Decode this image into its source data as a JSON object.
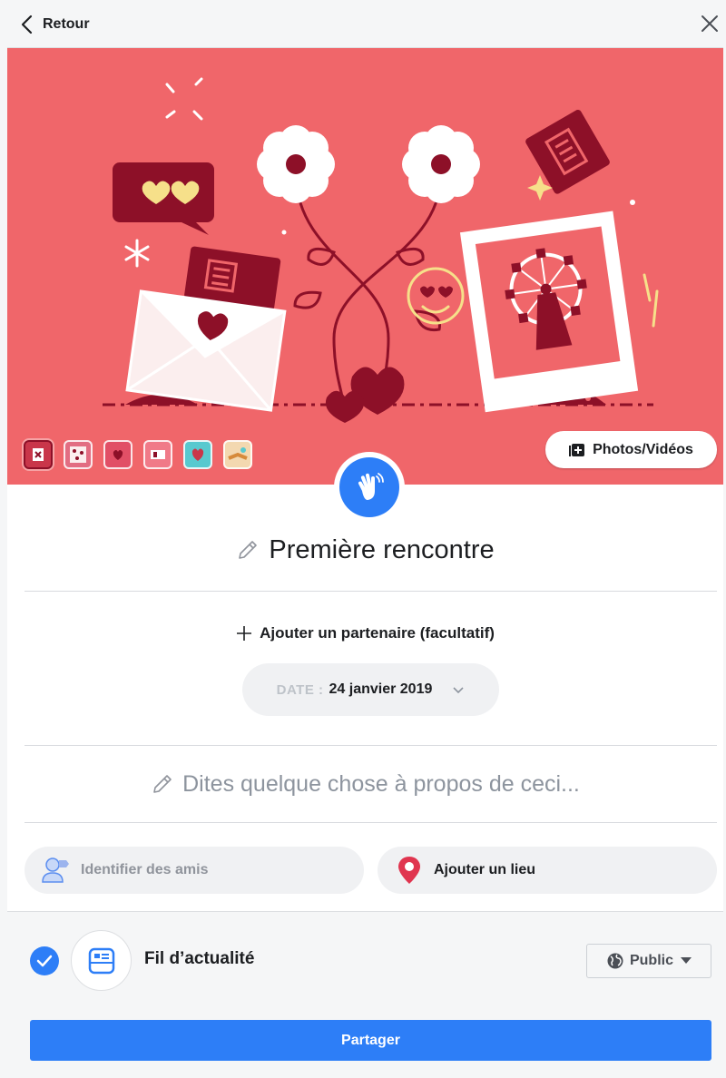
{
  "header": {
    "back_label": "Retour"
  },
  "banner": {
    "photos_button_label": "Photos/Vidéos",
    "thumbnails": [
      {
        "name": "envelope-x",
        "bg": "#c9364a"
      },
      {
        "name": "hearts-pattern",
        "bg": "#e26d82"
      },
      {
        "name": "heart-card",
        "bg": "#e14f66"
      },
      {
        "name": "tickets",
        "bg": "#f07a88"
      },
      {
        "name": "heart-teal",
        "bg": "#58c9cf"
      },
      {
        "name": "hands",
        "bg": "#f3d8b0"
      }
    ]
  },
  "event": {
    "title": "Première rencontre"
  },
  "partner": {
    "label": "Ajouter un partenaire (facultatif)"
  },
  "date": {
    "label": "DATE :",
    "value": "24 janvier 2019"
  },
  "composer": {
    "placeholder": "Dites quelque chose à propos de ceci..."
  },
  "actions": {
    "tag_friends": "Identifier des amis",
    "add_place": "Ajouter un lieu"
  },
  "footer": {
    "feed_label": "Fil d’actualité",
    "privacy": "Public",
    "share_label": "Partager"
  },
  "colors": {
    "accent": "#2d7ef7",
    "banner": "#f0666a",
    "dark_red": "#8d1028",
    "cream": "#f6e08a"
  },
  "icons": [
    "chevron-left-icon",
    "close-icon",
    "add-photo-icon",
    "wave-hand-icon",
    "pencil-icon",
    "plus-icon",
    "chevron-down-icon",
    "tag-person-icon",
    "map-pin-icon",
    "check-icon",
    "news-feed-icon",
    "globe-icon",
    "caret-down-icon"
  ]
}
